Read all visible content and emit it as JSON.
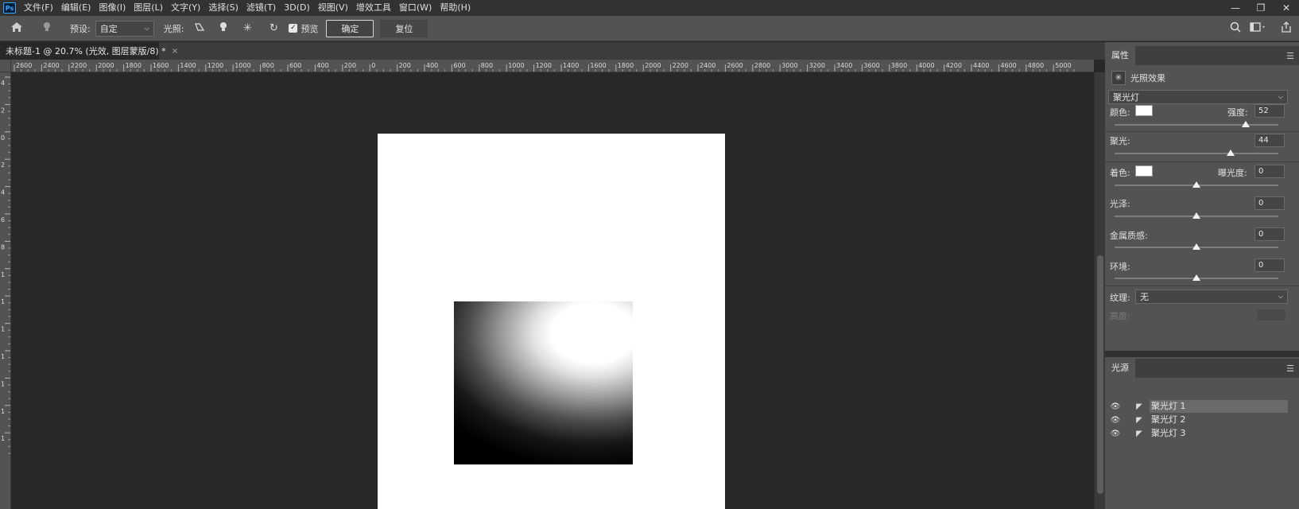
{
  "menubar": {
    "logo": "Ps",
    "items": [
      "文件(F)",
      "编辑(E)",
      "图像(I)",
      "图层(L)",
      "文字(Y)",
      "选择(S)",
      "滤镜(T)",
      "3D(D)",
      "视图(V)",
      "增效工具",
      "窗口(W)",
      "帮助(H)"
    ],
    "window_controls": {
      "minimize": "—",
      "restore": "❐",
      "close": "✕"
    }
  },
  "optionsbar": {
    "preset_label": "预设:",
    "preset_value": "自定",
    "lights_label": "光照:",
    "preview_label": "预览",
    "preview_checked": true,
    "ok_label": "确定",
    "reset_label": "复位",
    "icons": {
      "home": "home-icon",
      "search": "search-icon",
      "workspace": "workspace-icon",
      "share": "share-icon"
    }
  },
  "document_tab": {
    "title": "未标题-1 @ 20.7% (光效, 图层蒙版/8) *",
    "close": "×"
  },
  "ruler": {
    "h_ticks": [
      "2600",
      "2400",
      "2200",
      "2000",
      "1800",
      "1600",
      "1400",
      "1200",
      "1000",
      "800",
      "600",
      "400",
      "200",
      "0",
      "200",
      "400",
      "600",
      "800",
      "1000",
      "1200",
      "1400",
      "1600",
      "1800",
      "2000",
      "2200",
      "2400",
      "2600",
      "2800",
      "3000",
      "3200",
      "3400",
      "3600",
      "3800",
      "4000",
      "4200",
      "4400",
      "4600",
      "4800",
      "5000"
    ],
    "v_ticks": [
      "4",
      "2",
      "0",
      "2",
      "4",
      "6",
      "8",
      "1",
      "1",
      "1",
      "1",
      "1",
      "1",
      "1"
    ]
  },
  "properties_panel": {
    "tab_label": "属性",
    "effect_title": "光照效果",
    "light_type": "聚光灯",
    "color_label": "颜色:",
    "color_value": "#ffffff",
    "intensity_label": "强度:",
    "intensity_value": "52",
    "hotspot_label": "聚光:",
    "hotspot_value": "44",
    "colorize_label": "着色:",
    "colorize_value": "#ffffff",
    "exposure_label": "曝光度:",
    "exposure_value": "0",
    "gloss_label": "光泽:",
    "gloss_value": "0",
    "metallic_label": "金属质感:",
    "metallic_value": "0",
    "ambience_label": "环境:",
    "ambience_value": "0",
    "texture_label": "纹理:",
    "texture_value": "无",
    "height_label": "高度:",
    "sliders": {
      "intensity": 0.8,
      "hotspot": 0.71,
      "exposure": 0.5,
      "gloss": 0.5,
      "metallic": 0.5,
      "ambience": 0.5
    }
  },
  "light_sources_panel": {
    "tab_label": "光源",
    "lights": [
      {
        "label": "聚光灯 1",
        "selected": true
      },
      {
        "label": "聚光灯 2",
        "selected": false
      },
      {
        "label": "聚光灯 3",
        "selected": false
      }
    ]
  }
}
